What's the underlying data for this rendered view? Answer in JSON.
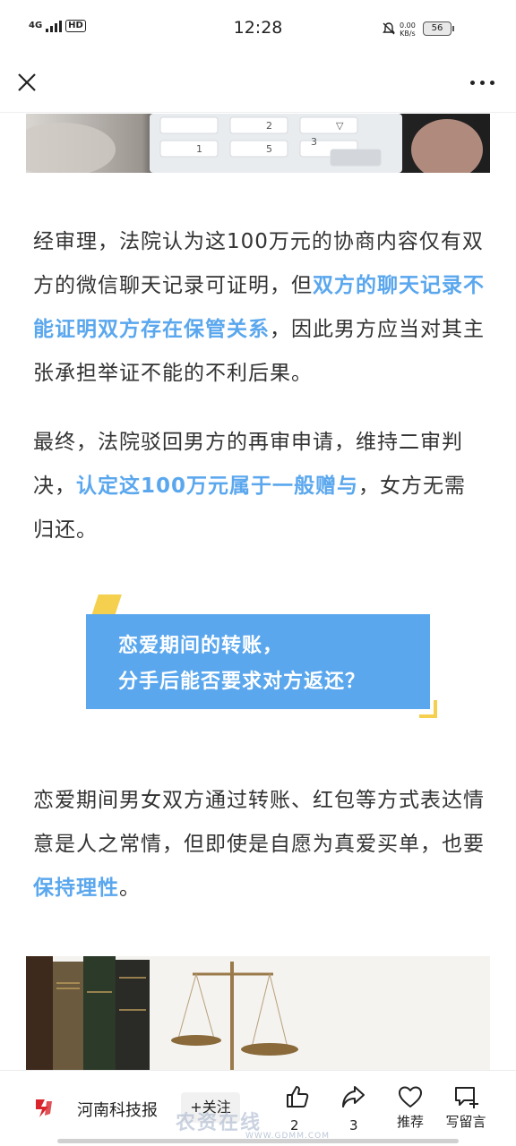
{
  "status_bar": {
    "network": "4G",
    "hd": "HD",
    "time": "12:28",
    "speed_value": "0.00",
    "speed_unit": "KB/s",
    "battery": "56"
  },
  "article": {
    "paragraph1": {
      "before": "经审理，法院认为这100万元的协商内容仅有双方的微信聊天记录可证明，但",
      "highlight": "双方的聊天记录不能证明双方存在保管关系",
      "after": "，因此男方应当对其主张承担举证不能的不利后果。"
    },
    "paragraph2": {
      "before": "最终，法院驳回男方的再审申请，维持二审判决，",
      "highlight": "认定这100万元属于一般赠与",
      "after": "，女方无需归还。"
    },
    "section_heading": {
      "line1": "恋爱期间的转账，",
      "line2": "分手后能否要求对方返还？"
    },
    "paragraph3": {
      "before": "恋爱期间男女双方通过转账、红包等方式表达情意是人之常情，但即使是自愿为真爱买单，也要",
      "highlight": "保持理性",
      "after": "。"
    }
  },
  "bottom_bar": {
    "source_name": "河南科技报",
    "follow_label": "+关注",
    "like_count": "2",
    "share_count": "3",
    "recommend_label": "推荐",
    "comment_label": "写留言"
  },
  "watermark": {
    "text": "农资在线",
    "url": "WWW.GDMM.COM"
  },
  "colors": {
    "highlight": "#5aa7ee",
    "accent_yellow": "#f5d04e"
  }
}
